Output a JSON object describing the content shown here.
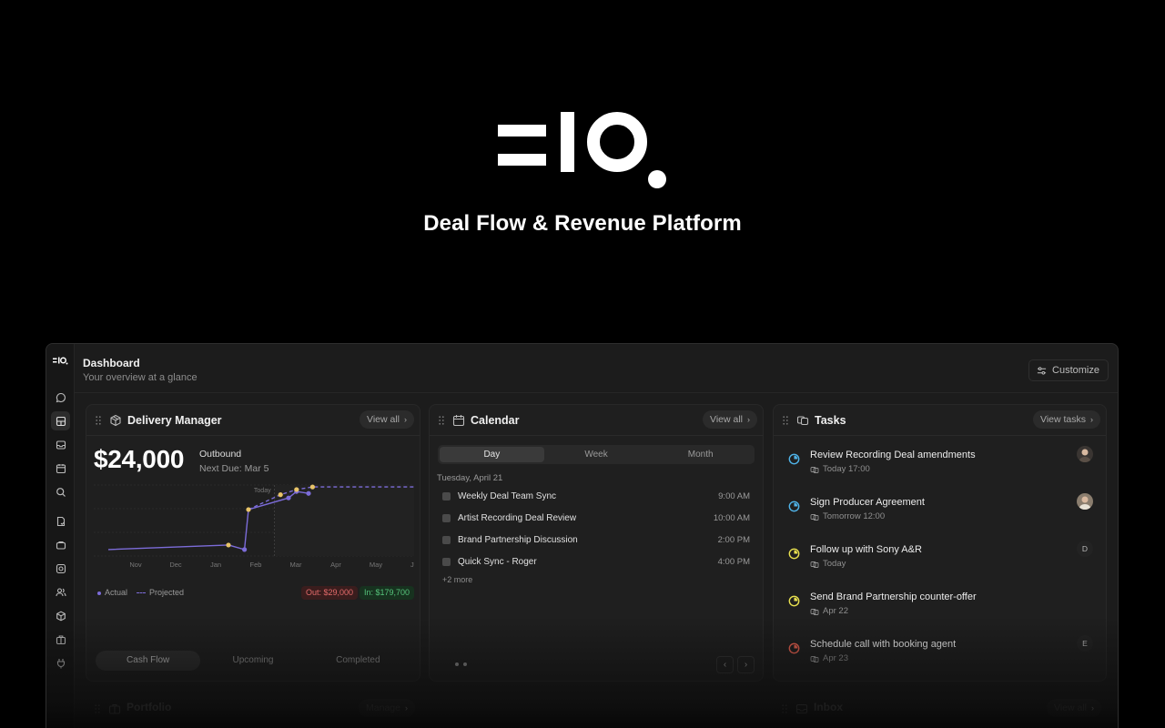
{
  "hero": {
    "logo_alt": "=IO.",
    "tagline": "Deal Flow & Revenue Platform"
  },
  "sidebar": {
    "logo": "=IO.",
    "items": [
      {
        "icon": "chat-icon",
        "active": false
      },
      {
        "icon": "dashboard-icon",
        "active": true
      },
      {
        "icon": "inbox-icon",
        "active": false
      },
      {
        "icon": "calendar-icon",
        "active": false
      },
      {
        "icon": "search-icon",
        "active": false
      },
      {
        "icon": "contract-icon",
        "active": false
      },
      {
        "icon": "folder-icon",
        "active": false
      },
      {
        "icon": "camera-icon",
        "active": false
      },
      {
        "icon": "users-icon",
        "active": false
      },
      {
        "icon": "package-icon",
        "active": false
      },
      {
        "icon": "briefcase-icon",
        "active": false
      },
      {
        "icon": "plug-icon",
        "active": false
      }
    ]
  },
  "header": {
    "title": "Dashboard",
    "subtitle": "Your overview at a glance",
    "customize_label": "Customize"
  },
  "delivery": {
    "title": "Delivery Manager",
    "view_all": "View all",
    "amount": "$24,000",
    "label": "Outbound",
    "next_due": "Next Due: Mar 5",
    "legend_actual": "Actual",
    "legend_projected": "Projected",
    "out_badge": "Out: $29,000",
    "in_badge": "In: $179,700",
    "tabs": [
      "Cash Flow",
      "Upcoming",
      "Completed"
    ],
    "active_tab": "Cash Flow"
  },
  "chart_data": {
    "type": "line",
    "x": [
      "Nov",
      "Dec",
      "Jan",
      "Feb",
      "Mar",
      "Apr",
      "May",
      "Jun"
    ],
    "today_label": "Today",
    "today_position": "Mar",
    "series": [
      {
        "name": "Actual",
        "color": "#7c6cd9",
        "points": [
          {
            "t": 0.0,
            "v": 0.1
          },
          {
            "t": 3.0,
            "v": 0.17
          },
          {
            "t": 3.4,
            "v": 0.1
          },
          {
            "t": 3.5,
            "v": 0.72
          },
          {
            "t": 4.5,
            "v": 0.9
          },
          {
            "t": 4.7,
            "v": 1.0
          },
          {
            "t": 5.0,
            "v": 0.97
          }
        ]
      },
      {
        "name": "Projected",
        "color": "#7c6cd9",
        "dashed": true,
        "points": [
          {
            "t": 3.5,
            "v": 0.72
          },
          {
            "t": 4.3,
            "v": 0.95
          },
          {
            "t": 4.7,
            "v": 1.03
          },
          {
            "t": 5.1,
            "v": 1.07
          },
          {
            "t": 8.0,
            "v": 1.07
          }
        ]
      }
    ],
    "markers_projected_color": "#e8c468",
    "grid": true
  },
  "calendar": {
    "title": "Calendar",
    "view_all": "View all",
    "tabs": [
      "Day",
      "Week",
      "Month"
    ],
    "active_tab": "Day",
    "date": "Tuesday, April 21",
    "events": [
      {
        "title": "Weekly Deal Team Sync",
        "time": "9:00 AM"
      },
      {
        "title": "Artist Recording Deal Review",
        "time": "10:00 AM"
      },
      {
        "title": "Brand Partnership Discussion",
        "time": "2:00 PM"
      },
      {
        "title": "Quick Sync - Roger",
        "time": "4:00 PM"
      }
    ],
    "more": "+2 more",
    "prev": "‹",
    "next": "›"
  },
  "tasks": {
    "title": "Tasks",
    "view_tasks": "View tasks",
    "items": [
      {
        "title": "Review Recording Deal amendments",
        "due": "Today 17:00",
        "ring_color": "#4fb3e8",
        "assignee": "avatar"
      },
      {
        "title": "Sign Producer Agreement",
        "due": "Tomorrow 12:00",
        "ring_color": "#4fb3e8",
        "assignee": "avatar"
      },
      {
        "title": "Follow up with Sony A&R",
        "due": "Today",
        "ring_color": "#e8e04f",
        "assignee": "D"
      },
      {
        "title": "Send Brand Partnership counter-offer",
        "due": "Apr 22",
        "ring_color": "#e8e04f",
        "assignee": ""
      },
      {
        "title": "Schedule call with booking agent",
        "due": "Apr 23",
        "ring_color": "#e8604f",
        "assignee": "E"
      }
    ]
  },
  "bottom_cards": {
    "portfolio_title": "Portfolio",
    "portfolio_btn": "Manage",
    "inbox_title": "Inbox",
    "inbox_btn": "View all"
  }
}
